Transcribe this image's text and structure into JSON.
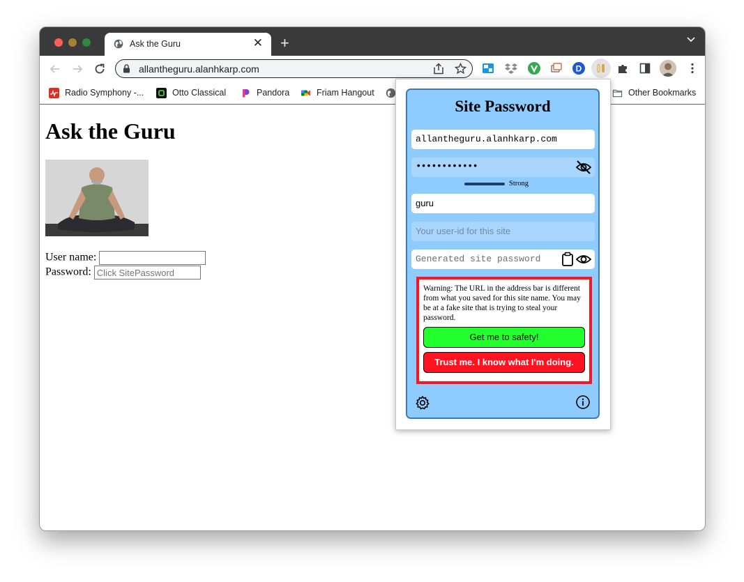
{
  "browser": {
    "tab": {
      "title": "Ask the Guru"
    },
    "address_bar": {
      "url": "allantheguru.alanhkarp.com"
    },
    "bookmarks": [
      {
        "label": "Radio Symphony -...",
        "icon": "radio-icon",
        "color": "#d93025"
      },
      {
        "label": "Otto Classical",
        "icon": "otto-icon",
        "color": "#111111"
      },
      {
        "label": "Pandora",
        "icon": "pandora-icon",
        "color": "#7b3fe4"
      },
      {
        "label": "Friam Hangout",
        "icon": "meet-icon",
        "color": "#00832d"
      }
    ],
    "other_bookmarks": "Other Bookmarks"
  },
  "page": {
    "heading": "Ask the Guru",
    "username_label": "User name:",
    "password_label": "Password:",
    "password_placeholder": "Click SitePassword"
  },
  "sitepassword": {
    "title": "Site Password",
    "domain_value": "allantheguru.alanhkarp.com",
    "super_password_masked": "••••••••••••",
    "strength_label": "Strong",
    "sitename_value": "guru",
    "userid_placeholder": "Your user-id for this site",
    "generated_placeholder": "Generated site password",
    "warning_text": "Warning: The URL in the address bar is different from what you saved for this site name. You may be at a fake site that is trying to steal your password.",
    "safety_button": "Get me to safety!",
    "trust_button": "Trust me. I know what I'm doing.",
    "colors": {
      "panel": "#8ecbff",
      "warning_border": "#ff1320",
      "safety": "#23ff2d",
      "trust": "#ff1320"
    }
  }
}
